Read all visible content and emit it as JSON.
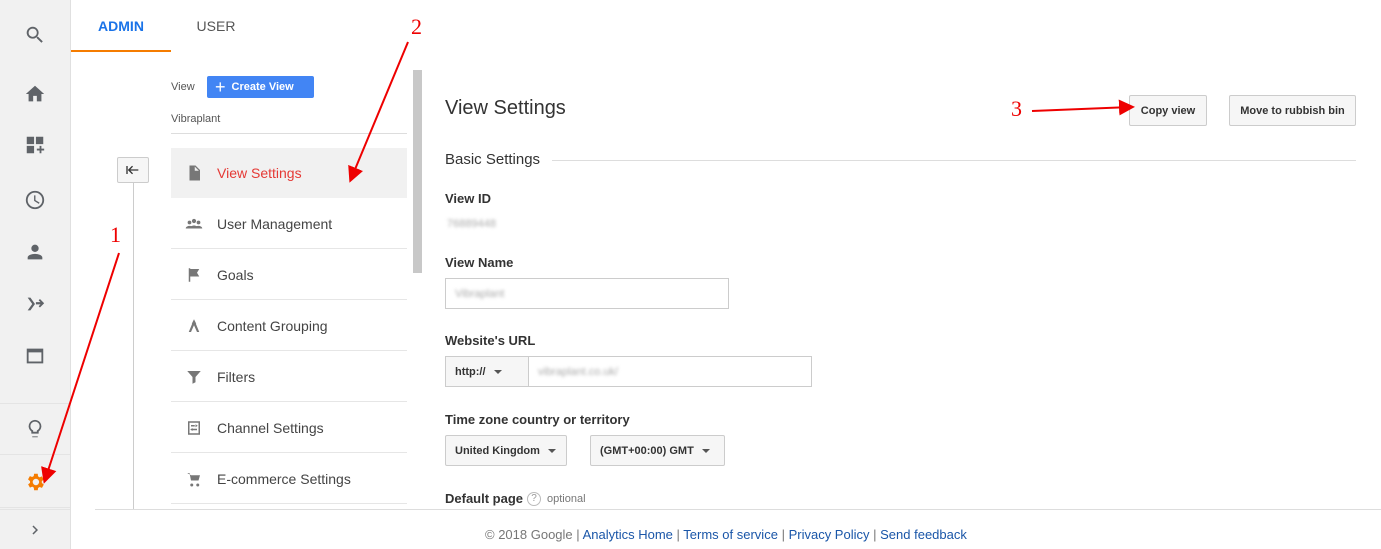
{
  "tabs": {
    "admin": "ADMIN",
    "user": "USER"
  },
  "rail": [
    {
      "icon": "search-icon"
    },
    {
      "icon": "home-icon"
    },
    {
      "icon": "customization-icon"
    },
    {
      "icon": "clock-icon"
    },
    {
      "icon": "person-icon"
    },
    {
      "icon": "acquisition-icon"
    },
    {
      "icon": "behavior-icon"
    },
    {
      "icon": "lightbulb-icon"
    },
    {
      "icon": "gear-icon"
    },
    {
      "icon": "chevron-right-icon"
    }
  ],
  "view_column": {
    "label": "View",
    "create_view": "Create View",
    "view_name": "Vibraplant",
    "items": [
      {
        "label": "View Settings",
        "icon": "document-icon"
      },
      {
        "label": "User Management",
        "icon": "people-icon"
      },
      {
        "label": "Goals",
        "icon": "flag-icon"
      },
      {
        "label": "Content Grouping",
        "icon": "content-grouping-icon"
      },
      {
        "label": "Filters",
        "icon": "filter-icon"
      },
      {
        "label": "Channel Settings",
        "icon": "channel-settings-icon"
      },
      {
        "label": "E-commerce Settings",
        "icon": "cart-icon"
      }
    ]
  },
  "main": {
    "title": "View Settings",
    "copy_view": "Copy view",
    "move_to_bin": "Move to rubbish bin",
    "section": "Basic Settings",
    "view_id_label": "View ID",
    "view_id_value": "76889448",
    "view_name_label": "View Name",
    "view_name_value": "Vibraplant",
    "url_label": "Website's URL",
    "url_protocol": "http://",
    "url_value": "vibraplant.co.uk/",
    "tz_label": "Time zone country or territory",
    "tz_country": "United Kingdom",
    "tz_offset": "(GMT+00:00) GMT",
    "default_page_label": "Default page",
    "help": "?",
    "optional": "optional"
  },
  "footer": {
    "copyright": "© 2018 Google",
    "sep": "|",
    "links": [
      "Analytics Home",
      "Terms of service",
      "Privacy Policy",
      "Send feedback"
    ]
  },
  "annotations": [
    "1",
    "2",
    "3"
  ],
  "colors": {
    "accent": "#f57c00",
    "link": "#1a73e8",
    "button_blue": "#4285f4",
    "annotation": "#e00000",
    "selected_text": "#e53935"
  }
}
